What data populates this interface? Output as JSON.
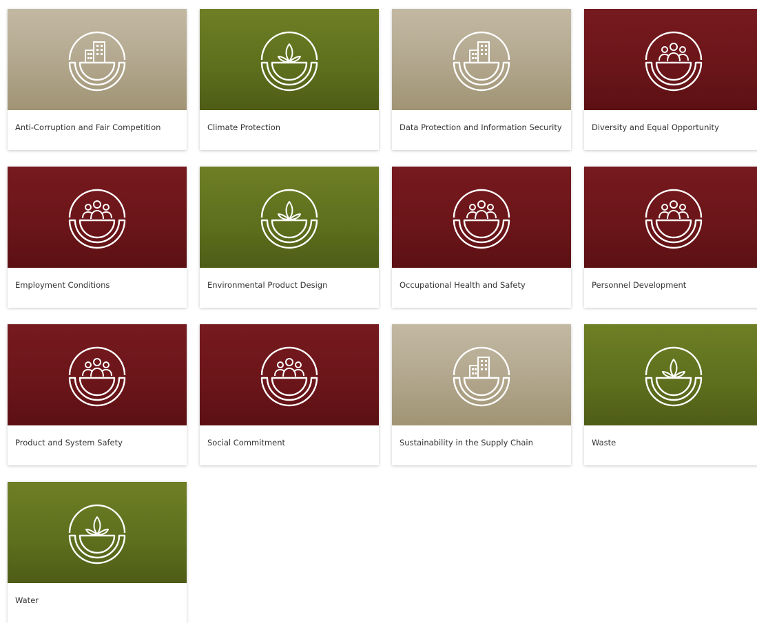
{
  "cards": [
    {
      "label": "Anti-Corruption and Fair Competition",
      "theme": "beige",
      "icon": "building-icon"
    },
    {
      "label": "Climate Protection",
      "theme": "green",
      "icon": "plant-icon"
    },
    {
      "label": "Data Protection and Information Security",
      "theme": "beige",
      "icon": "building-icon"
    },
    {
      "label": "Diversity and Equal Opportunity",
      "theme": "red",
      "icon": "people-icon"
    },
    {
      "label": "Employment Conditions",
      "theme": "red",
      "icon": "people-icon"
    },
    {
      "label": "Environmental Product Design",
      "theme": "green",
      "icon": "plant-icon"
    },
    {
      "label": "Occupational Health and Safety",
      "theme": "red",
      "icon": "people-icon"
    },
    {
      "label": "Personnel Development",
      "theme": "red",
      "icon": "people-icon"
    },
    {
      "label": "Product and System Safety",
      "theme": "red",
      "icon": "people-icon"
    },
    {
      "label": "Social Commitment",
      "theme": "red",
      "icon": "people-icon"
    },
    {
      "label": "Sustainability in the Supply Chain",
      "theme": "beige",
      "icon": "building-icon"
    },
    {
      "label": "Waste",
      "theme": "green",
      "icon": "plant-icon"
    },
    {
      "label": "Water",
      "theme": "green",
      "icon": "plant-icon"
    }
  ],
  "colors": {
    "beige": "#b3a88f",
    "green": "#5d6e1d",
    "red": "#6a1519",
    "label_text": "#333333"
  }
}
